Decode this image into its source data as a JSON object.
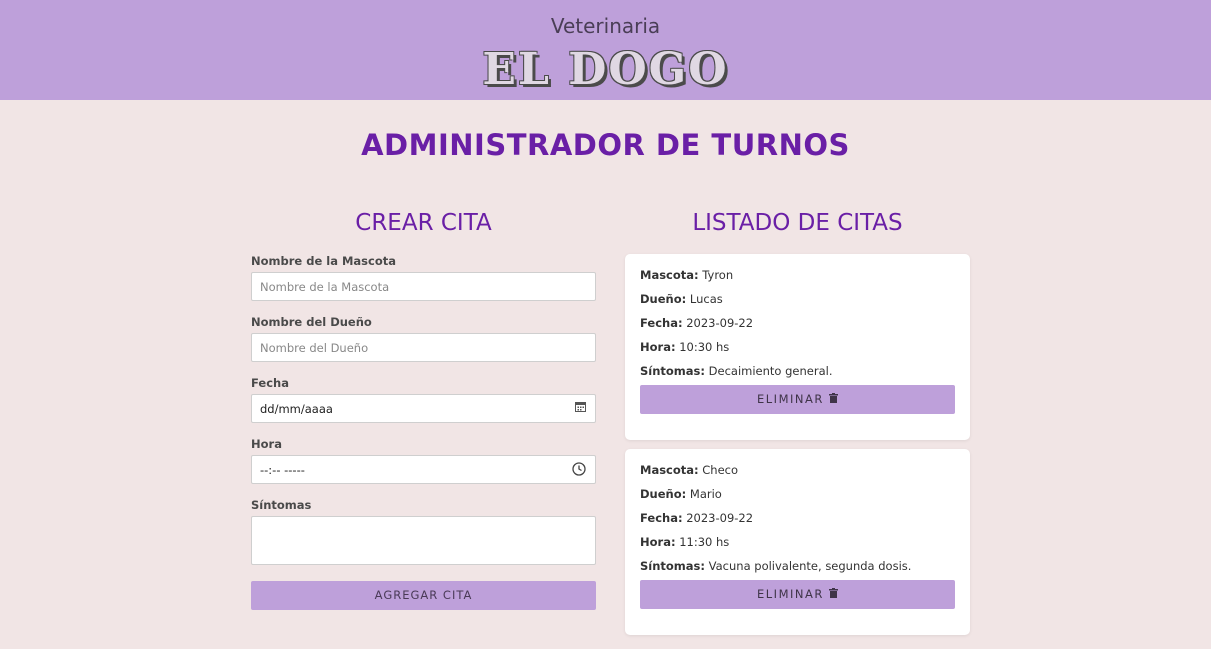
{
  "header": {
    "subtitle": "Veterinaria",
    "brand": "EL DOGO"
  },
  "page_title": "ADMINISTRADOR DE TURNOS",
  "form": {
    "title": "CREAR CITA",
    "fields": [
      {
        "label": "Nombre de la Mascota",
        "placeholder": "Nombre de la Mascota"
      },
      {
        "label": "Nombre del Dueño",
        "placeholder": "Nombre del Dueño"
      },
      {
        "label": "Fecha",
        "value": "dd/mm/aaaa",
        "icon": "calendar-icon"
      },
      {
        "label": "Hora",
        "value": "--:-- -----",
        "icon": "clock-icon"
      },
      {
        "label": "Síntomas",
        "value": ""
      }
    ],
    "submit_label": "AGREGAR CITA"
  },
  "list": {
    "title": "LISTADO DE CITAS",
    "labels": {
      "pet": "Mascota:",
      "owner": "Dueño:",
      "date": "Fecha:",
      "time": "Hora:",
      "symptoms": "Síntomas:"
    },
    "items": [
      {
        "pet": "Tyron",
        "owner": "Lucas",
        "date": "2023-09-22",
        "time": "10:30 hs",
        "symptoms": "Decaimiento general.",
        "delete_label": "ELIMINAR",
        "delete_icon": "trash-icon"
      },
      {
        "pet": "Checo",
        "owner": "Mario",
        "date": "2023-09-22",
        "time": "11:30 hs",
        "symptoms": "Vacuna polivalente, segunda dosis.",
        "delete_label": "ELIMINAR",
        "delete_icon": "trash-icon"
      }
    ]
  },
  "colors": {
    "header_bg": "#bea0da",
    "page_bg": "#f1e5e5",
    "accent_text": "#6a1fa6",
    "button_bg": "#bea0da"
  }
}
